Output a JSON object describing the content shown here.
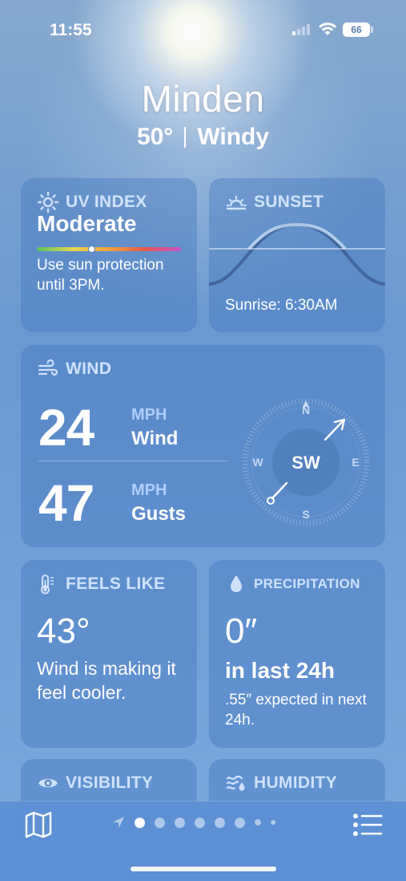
{
  "status": {
    "time": "11:55",
    "battery": "66"
  },
  "header": {
    "city": "Minden",
    "temp": "50°",
    "condition": "Windy"
  },
  "uv": {
    "title": "UV INDEX",
    "level": "Moderate",
    "desc": "Use sun protection until 3PM."
  },
  "sunset": {
    "title": "SUNSET",
    "sunrise": "Sunrise: 6:30AM"
  },
  "wind": {
    "title": "WIND",
    "speed": "24",
    "speed_unit": "MPH",
    "speed_label": "Wind",
    "gusts": "47",
    "gusts_unit": "MPH",
    "gusts_label": "Gusts",
    "direction": "SW",
    "compass": {
      "n": "N",
      "e": "E",
      "s": "S",
      "w": "W"
    }
  },
  "feels": {
    "title": "FEELS LIKE",
    "value": "43°",
    "desc": "Wind is making it feel cooler."
  },
  "precip": {
    "title": "PRECIPITATION",
    "value": "0″",
    "sub": "in last 24h",
    "desc": ".55″ expected in next 24h."
  },
  "visibility": {
    "title": "VISIBILITY"
  },
  "humidity": {
    "title": "HUMIDITY"
  },
  "toolbar": {
    "icons": [
      "map-icon",
      "location-arrow-icon",
      "list-icon"
    ],
    "page_dots": 8,
    "active_dot": 1
  }
}
